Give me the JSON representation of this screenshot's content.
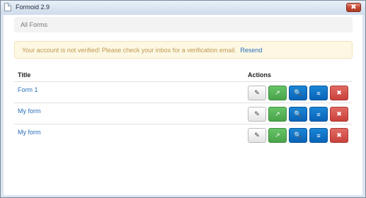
{
  "window": {
    "title": "Formoid 2.9",
    "close_glyph": "✖",
    "icons": {
      "app": "document-icon",
      "close": "close-icon"
    }
  },
  "breadcrumb": {
    "label": "All Forms"
  },
  "alert": {
    "message": "Your account is not verified! Please check your inbox for a verification email.",
    "link": "Resend"
  },
  "table": {
    "headers": {
      "title": "Title",
      "actions": "Actions"
    },
    "rows": [
      {
        "title": "Form 1"
      },
      {
        "title": "My form"
      },
      {
        "title": "My form"
      }
    ],
    "action_icons": {
      "edit": {
        "icon": "pencil-icon",
        "glyph": "✎"
      },
      "share": {
        "icon": "share-icon",
        "glyph": "↗"
      },
      "view": {
        "icon": "search-icon",
        "glyph": "🔍"
      },
      "list": {
        "icon": "list-icon",
        "glyph": "≡"
      },
      "delete": {
        "icon": "delete-icon",
        "glyph": "✖"
      }
    }
  },
  "colors": {
    "link": "#2a6ebd",
    "alert_bg": "#fcf8e3",
    "alert_text": "#c09853",
    "share_btn": "#4aa34a",
    "primary_btn": "#0a63b7",
    "danger_btn": "#c9413b"
  }
}
